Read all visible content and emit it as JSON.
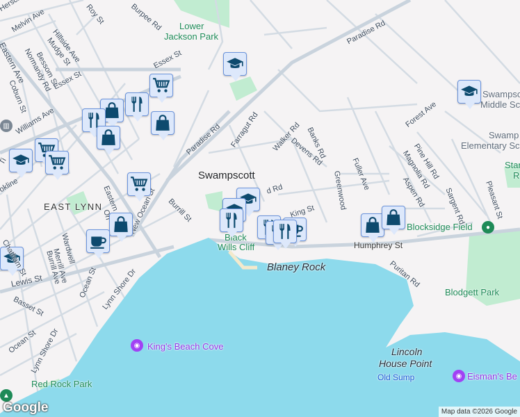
{
  "map": {
    "colors": {
      "land": "#f5f3f4",
      "water": "#8ddaec",
      "park": "#c1ecd1",
      "road": "#d3dbe3",
      "marker_bg": "#dde8fb",
      "marker_border": "#6a93dc",
      "icon": "#0d4a6e"
    },
    "places": {
      "swampscott": "Swampscott",
      "east_lynn": "EAST LYNN",
      "lower_jackson_park_1": "Lower",
      "lower_jackson_park_2": "Jackson Park",
      "black_wills_cliff_1": "Black",
      "black_wills_cliff_2": "Wills Cliff",
      "blaney_rock": "Blaney Rock",
      "blocksidge_field": "Blocksidge Field",
      "blodgett_park": "Blodgett Park",
      "lincoln_1": "Lincoln",
      "lincoln_2": "House Point",
      "old_sump": "Old Sump",
      "kings_beach_cove": "King's Beach Cove",
      "eismans": "Eisman's Be",
      "red_rock_park": "Red Rock Park",
      "middle_school_1": "Swampsc",
      "middle_school_2": "Middle Sc",
      "elementary_1": "Swamp",
      "elementary_2": "Elementary Sc",
      "stan_1": "Stan",
      "stan_2": "R"
    },
    "streets": {
      "herschel": "Herschel St",
      "melvin": "Melvin Ave",
      "hillside": "Hillside Ave",
      "mudge": "Mudge St",
      "roy": "Roy St",
      "burpee": "Burpee Rd",
      "eastern_ave": "Eastern Ave",
      "normandy": "Normandy Rd",
      "bessom": "Bessom St",
      "essex1": "Essex St",
      "essex2": "Essex St",
      "coburn": "Coburn St",
      "williams": "Williams Ave",
      "paradise1": "Paradise Rd",
      "paradise2": "Paradise Rd",
      "farragut": "Farragut Rd",
      "walker": "Walker Rd",
      "devens": "Devens Rd",
      "banks": "Banks Rd",
      "greenwood": "Greenwood",
      "fuller": "Fuller Ave",
      "forest": "Forest Ave",
      "pine_hill": "Pine Hill Rd",
      "magnolia": "Magnolia Rd",
      "aspen": "Aspen Rd",
      "sargent": "Sargent Rd",
      "pleasant": "Pleasant St",
      "humphrey": "Humphrey St",
      "puritan": "Puritan Rd",
      "king": "King St",
      "burrill": "Burrill St",
      "new_ocean": "New Ocean St",
      "eastern_a2": "Eastern A",
      "wardwell": "Wardwell",
      "merrill": "Merrill Ave",
      "burrill_ave": "Burrill Ave",
      "chatham": "Chatham St",
      "lewis": "Lewis St",
      "basset": "Basset St",
      "ocean1": "Ocean St",
      "ocean2": "Ocean St",
      "lynn_shore": "Lynn Shore Dr",
      "brookline": "okline",
      "ti": "Ti",
      "field_rd": "d Rd",
      "on": "On"
    },
    "markers": [
      {
        "type": "school"
      },
      {
        "type": "cart"
      },
      {
        "type": "restaurant"
      },
      {
        "type": "bag"
      },
      {
        "type": "restaurant"
      },
      {
        "type": "bag"
      },
      {
        "type": "bag"
      },
      {
        "type": "school"
      },
      {
        "type": "cart"
      },
      {
        "type": "cart"
      },
      {
        "type": "cart"
      },
      {
        "type": "bag"
      },
      {
        "type": "cafe"
      },
      {
        "type": "school"
      },
      {
        "type": "school"
      },
      {
        "type": "school"
      },
      {
        "type": "restaurant"
      },
      {
        "type": "restaurant"
      },
      {
        "type": "restaurant"
      },
      {
        "type": "cafe"
      },
      {
        "type": "restaurant"
      },
      {
        "type": "bag"
      },
      {
        "type": "bag"
      },
      {
        "type": "school"
      }
    ],
    "attribution": "Map data ©2026 Google",
    "logo": "Google"
  }
}
